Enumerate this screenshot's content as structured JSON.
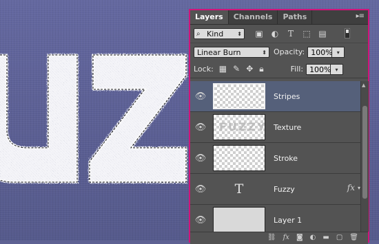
{
  "canvas": {
    "artwork_text": "FUZZY"
  },
  "panel": {
    "tabs": [
      {
        "label": "Layers"
      },
      {
        "label": "Channels"
      },
      {
        "label": "Paths"
      }
    ],
    "menu_icon": "panel-menu-icon",
    "filter": {
      "value": "Kind"
    },
    "blend_mode": "Linear Burn",
    "opacity_label": "Opacity:",
    "opacity_value": "100%",
    "lock_label": "Lock:",
    "fill_label": "Fill:",
    "fill_value": "100%",
    "layers": [
      {
        "name": "Stripes",
        "selected": true
      },
      {
        "name": "Texture",
        "thumb_text": "FUZZY"
      },
      {
        "name": "Stroke"
      },
      {
        "name": "Fuzzy",
        "type_icon": "T",
        "fx": "fx"
      },
      {
        "name": "Layer 1"
      }
    ]
  },
  "colors": {
    "panel_bg": "#535353",
    "panel_border": "#d2137a",
    "selected_layer": "#55607a",
    "canvas_bg": "#5e6293"
  }
}
